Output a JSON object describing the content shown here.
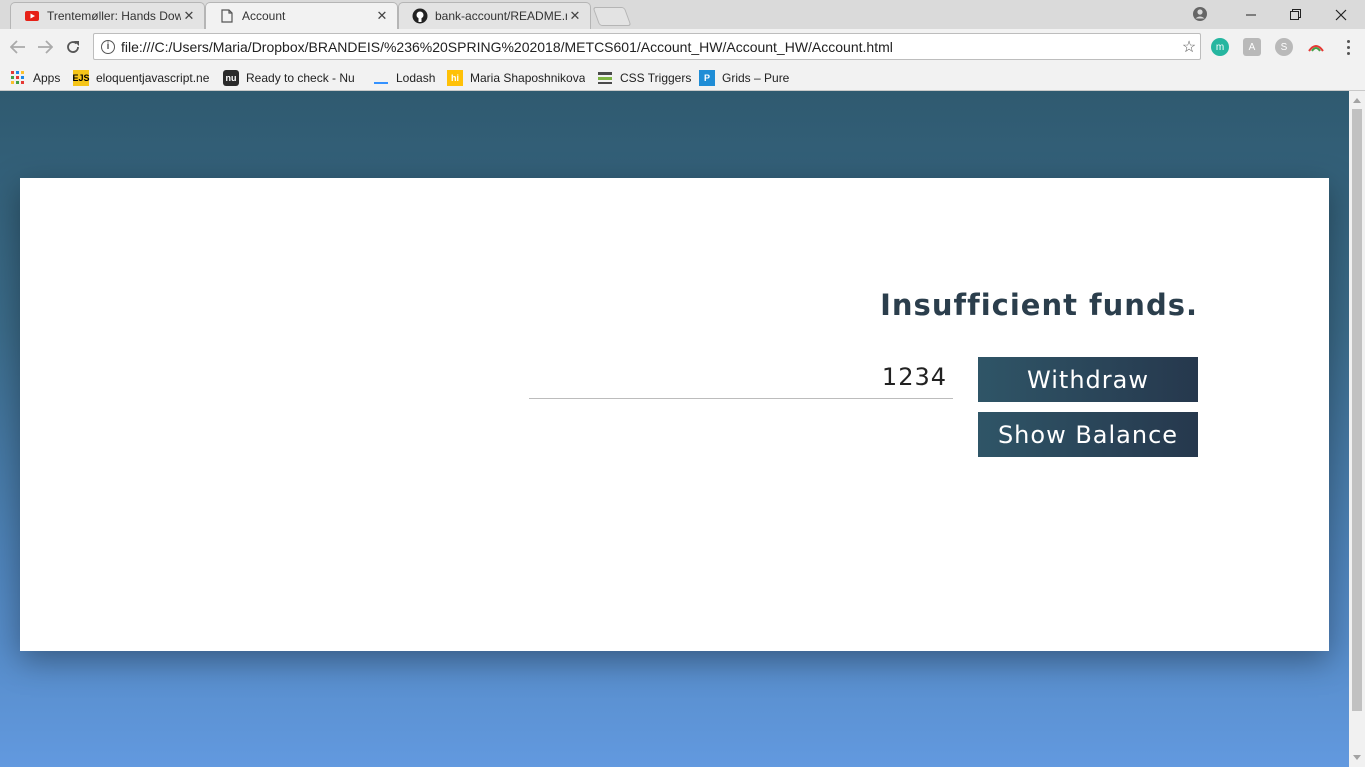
{
  "browser": {
    "tabs": [
      {
        "title": "Trentemøller: Hands Dow",
        "icon": "youtube-icon",
        "active": false
      },
      {
        "title": "Account",
        "icon": "page-icon",
        "active": true
      },
      {
        "title": "bank-account/README.m",
        "icon": "github-icon",
        "active": false
      }
    ],
    "tab_close": "✕",
    "url": "file:///C:/Users/Maria/Dropbox/BRANDEIS/%236%20SPRING%202018/METCS601/Account_HW/Account_HW/Account.html",
    "extensions": [
      {
        "name": "m-extension-icon",
        "label": "m",
        "color": "#26b6a0"
      },
      {
        "name": "translate-extension-icon",
        "label": "A",
        "color": "#b9b9b9"
      },
      {
        "name": "skype-extension-icon",
        "label": "S",
        "color": "#b9b9b9"
      }
    ],
    "bookmarks": [
      {
        "label": "Apps",
        "icon": "apps-grid-icon"
      },
      {
        "label": "eloquentjavascript.ne",
        "icon": "ejs-icon",
        "badge": "EJS"
      },
      {
        "label": "Ready to check - Nu I",
        "icon": "nu-icon",
        "badge": "nu"
      },
      {
        "label": "Lodash",
        "icon": "lodash-icon"
      },
      {
        "label": "Maria Shaposhnikova",
        "icon": "hi-icon",
        "badge": "hi"
      },
      {
        "label": "CSS Triggers",
        "icon": "css-triggers-icon"
      },
      {
        "label": "Grids – Pure",
        "icon": "pure-icon",
        "badge": "P"
      }
    ]
  },
  "app": {
    "message": "Insufficient funds.",
    "amount_value": "1234",
    "withdraw_label": "Withdraw",
    "balance_label": "Show Balance"
  },
  "colors": {
    "bg_top": "#2f5a70",
    "bg_bottom": "#6299df",
    "button": "#2c4a5e",
    "message": "#2b3e4c"
  }
}
